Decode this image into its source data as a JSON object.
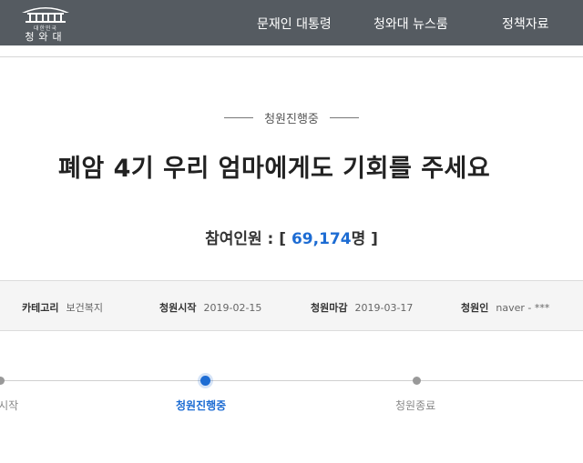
{
  "header": {
    "logo_small": "대한민국",
    "logo_text": "청와대",
    "nav": [
      {
        "label": "문재인 대통령"
      },
      {
        "label": "청와대 뉴스룸"
      },
      {
        "label": "정책자료"
      }
    ]
  },
  "petition": {
    "status": "청원진행중",
    "title": "폐암 4기 우리 엄마에게도 기회를 주세요",
    "count_label": "참여인원 :",
    "count_open": "[",
    "count_value": "69,174",
    "count_unit": "명",
    "count_close": "]",
    "meta": [
      {
        "label": "카테고리",
        "value": "보건복지"
      },
      {
        "label": "청원시작",
        "value": "2019-02-15"
      },
      {
        "label": "청원마감",
        "value": "2019-03-17"
      },
      {
        "label": "청원인",
        "value": "naver - ***"
      }
    ]
  },
  "progress": {
    "steps": [
      {
        "label": "청원시작"
      },
      {
        "label": "청원진행중"
      },
      {
        "label": "청원종료"
      }
    ]
  },
  "colors": {
    "topbar": "#555b61",
    "accent": "#1d6cd3"
  }
}
